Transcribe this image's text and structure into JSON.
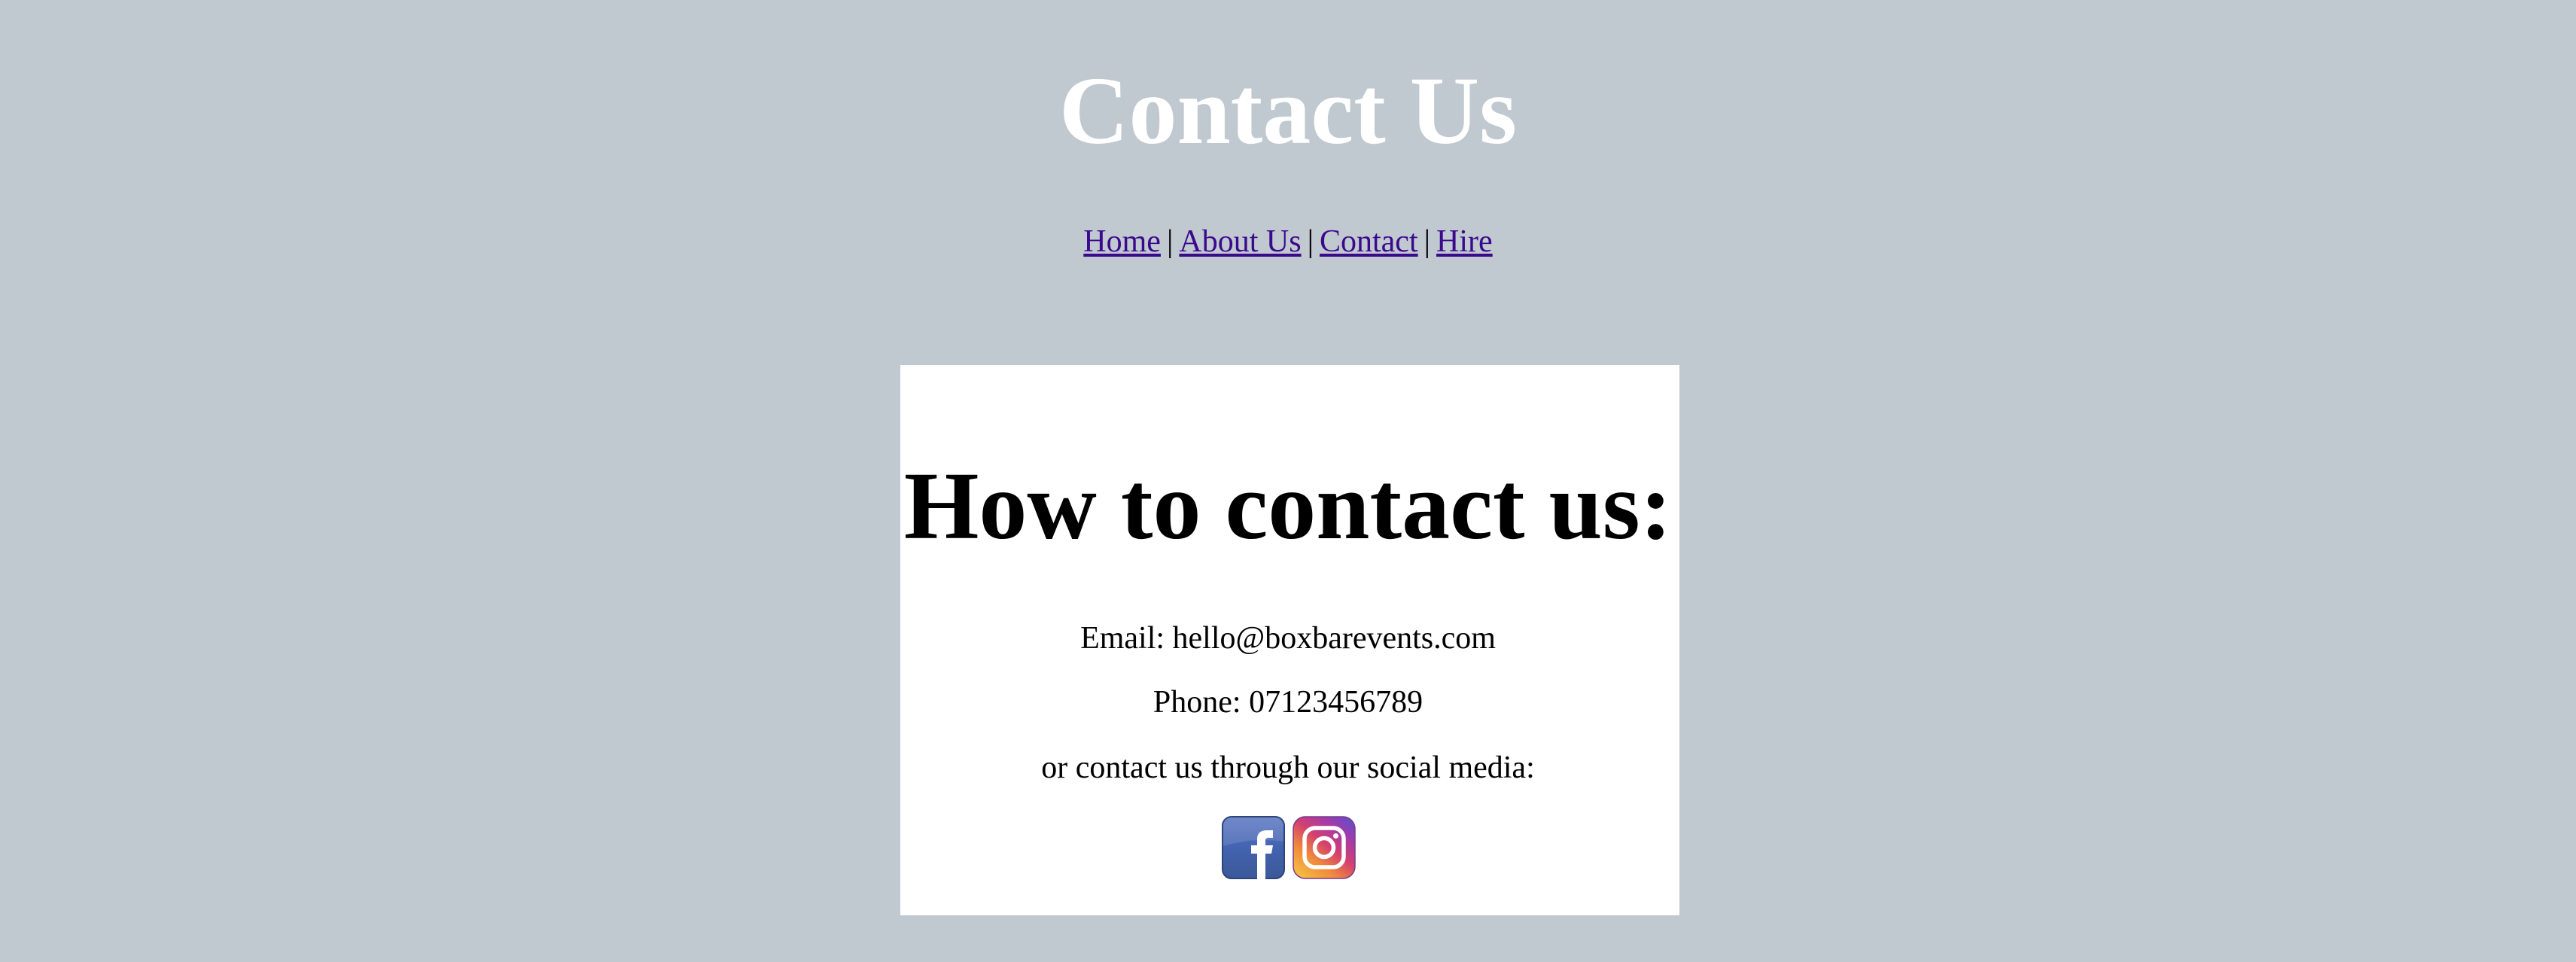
{
  "header": {
    "title": "Contact Us"
  },
  "nav": {
    "items": [
      {
        "label": "Home"
      },
      {
        "label": "About Us"
      },
      {
        "label": "Contact"
      },
      {
        "label": "Hire"
      }
    ],
    "separator": "|"
  },
  "contact": {
    "heading": "How to contact us:",
    "email": "Email: hello@boxbarevents.com",
    "phone": "Phone: 07123456789",
    "social_text": "or contact us through our social media:"
  },
  "social": [
    {
      "icon": "facebook-icon",
      "label": "f",
      "color": "#3b5998"
    },
    {
      "icon": "instagram-icon",
      "color": "#c13584"
    }
  ],
  "colors": {
    "background": "#c0c8d0",
    "card": "#ffffff",
    "title": "#ffffff",
    "link": "#3b0a8c"
  }
}
